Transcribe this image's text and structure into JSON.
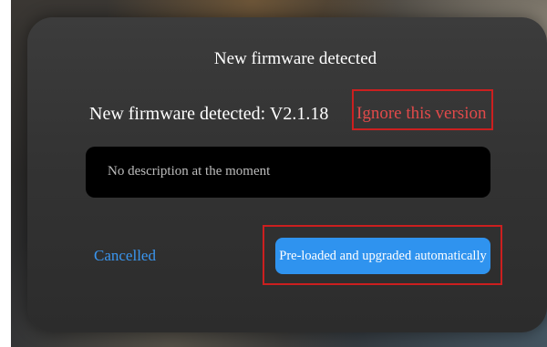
{
  "dialog": {
    "title": "New firmware detected",
    "firmware_text": "New firmware detected: V2.1.18",
    "ignore_label": "Ignore this version",
    "description": "No description at the moment",
    "cancel_label": "Cancelled",
    "primary_label": "Pre-loaded and upgraded automatically"
  },
  "colors": {
    "accent_blue": "#2f93ef",
    "link_blue": "#3a96f0",
    "warning_red": "#e24a4a",
    "highlight_red": "#cc1f1f",
    "dialog_bg": "#333333"
  }
}
